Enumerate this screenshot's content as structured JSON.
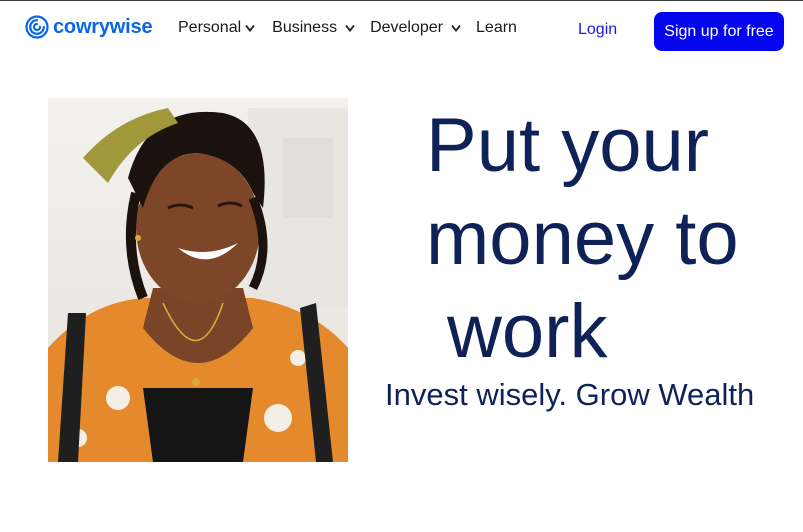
{
  "header": {
    "logo_text": "cowrywise",
    "nav": [
      {
        "label": "Personal"
      },
      {
        "label": "Business"
      },
      {
        "label": "Developer"
      },
      {
        "label": "Learn"
      }
    ],
    "login_label": "Login",
    "signup_label": "Sign up for free"
  },
  "hero": {
    "headline_lines": [
      "Put your",
      "money to",
      "work"
    ],
    "tagline": "Invest wisely. Grow Wealth",
    "image_icon": "woman-smiling-photo"
  },
  "colors": {
    "brand": "#0a66e4",
    "primary_button": "#0505f0",
    "login_link": "#1a1ae0",
    "headline": "#0e2258"
  }
}
